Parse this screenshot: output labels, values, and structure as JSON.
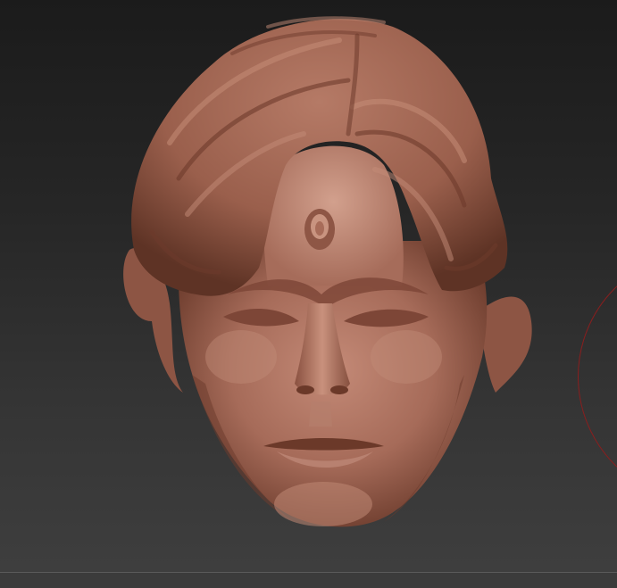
{
  "scene": {
    "subject": "sculpted-head-model",
    "material_color": "#a9705e",
    "material_shadow": "#5e3325",
    "material_highlight": "#d6a090",
    "background_top": "#1b1b1b",
    "background_bottom": "#3f3f3f",
    "brush_cursor_color": "#8a1e1e"
  },
  "icons": {
    "brush": "brush-cursor-icon"
  }
}
